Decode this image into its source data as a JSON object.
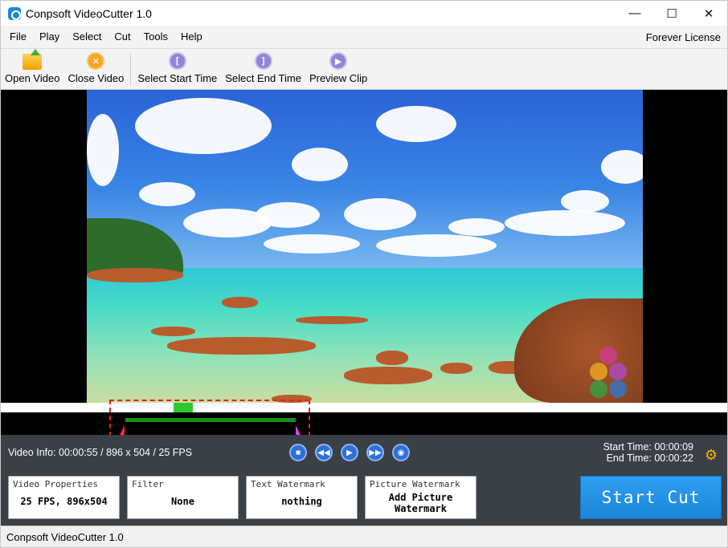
{
  "window": {
    "title": "Conpsoft VideoCutter 1.0",
    "controls": {
      "minimize": "—",
      "maximize": "☐",
      "close": "✕"
    }
  },
  "menu": {
    "items": [
      "File",
      "Play",
      "Select",
      "Cut",
      "Tools",
      "Help"
    ],
    "license": "Forever License"
  },
  "toolbar": {
    "open_video": "Open Video",
    "close_video": "Close Video",
    "select_start": "Select Start Time",
    "select_end": "Select End Time",
    "preview_clip": "Preview Clip",
    "icons": {
      "select_start": "[",
      "select_end": "]",
      "preview_clip": "▶"
    }
  },
  "info": {
    "video_info": "Video Info: 00:00:55 / 896 x 504 / 25 FPS",
    "start_time": "Start Time: 00:00:09",
    "end_time": "End Time: 00:00:22"
  },
  "playback": {
    "stop": "■",
    "rewind": "◀◀",
    "play": "▶",
    "forward": "▶▶",
    "snapshot": "◉"
  },
  "settings_icon": "⚙",
  "cards": {
    "video_properties": {
      "caption": "Video Properties",
      "value": "25 FPS, 896x504"
    },
    "filter": {
      "caption": "Filter",
      "value": "None"
    },
    "text_watermark": {
      "caption": "Text Watermark",
      "value": "nothing"
    },
    "picture_watermark": {
      "caption": "Picture Watermark",
      "value_line1": "Add Picture",
      "value_line2": "Watermark"
    }
  },
  "start_cut": "Start Cut",
  "status": "Conpsoft VideoCutter 1.0",
  "colors": {
    "panel_bg": "#3b3f46",
    "accent_blue": "#1a86db",
    "selection_border": "#e02020",
    "playhead": "#2ec82e",
    "cut_range": "#1b8e1b"
  }
}
